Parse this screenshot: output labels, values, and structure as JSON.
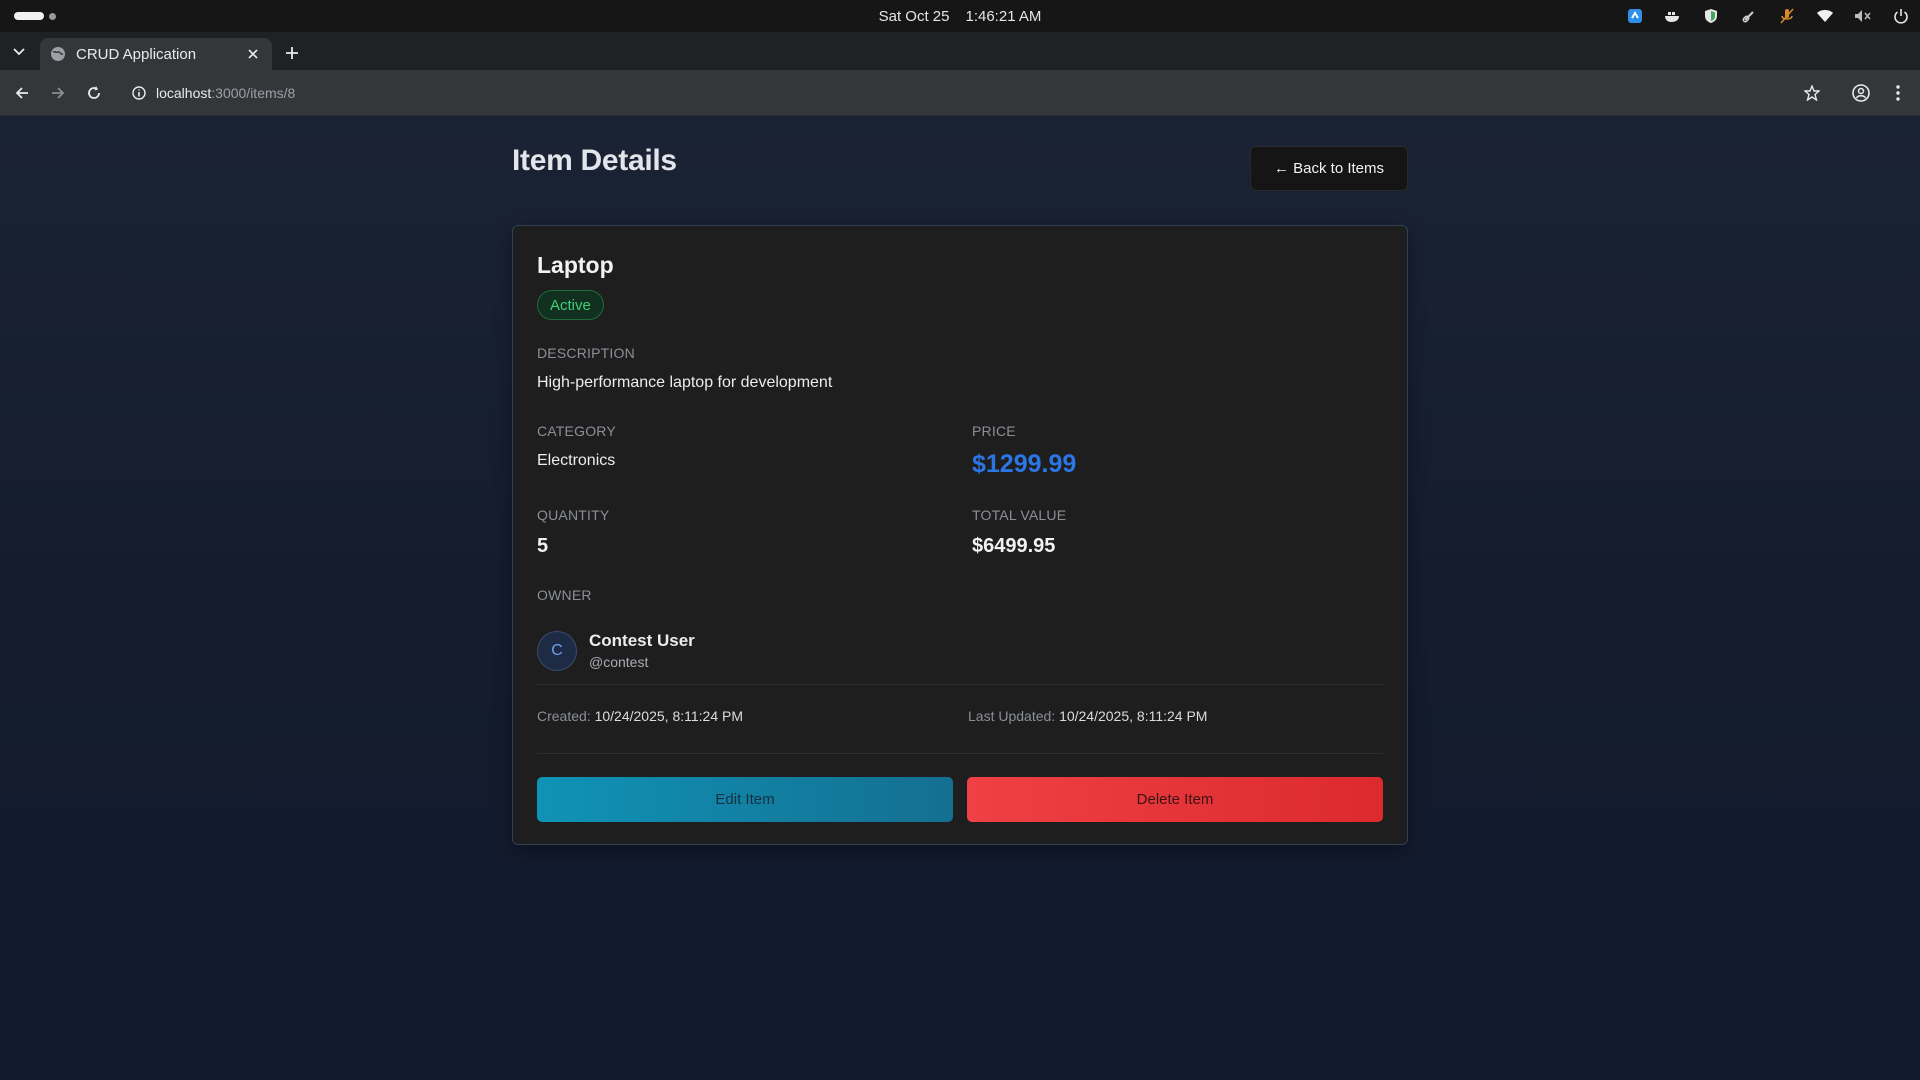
{
  "os": {
    "date": "Sat Oct 25",
    "time": "1:46:21 AM",
    "tray_icons": [
      "app-icon",
      "docker-icon",
      "shield-icon",
      "link-icon",
      "mic-off-icon",
      "wifi-icon",
      "volume-icon",
      "power-icon"
    ]
  },
  "browser": {
    "tab_title": "CRUD Application",
    "url_host": "localhost",
    "url_path": ":3000/items/8"
  },
  "page": {
    "title": "Item Details",
    "back_label": "← Back to Items"
  },
  "item": {
    "name": "Laptop",
    "status": "Active",
    "description_label": "DESCRIPTION",
    "description": "High-performance laptop for development",
    "category_label": "CATEGORY",
    "category": "Electronics",
    "price_label": "PRICE",
    "price": "$1299.99",
    "quantity_label": "QUANTITY",
    "quantity": "5",
    "total_label": "TOTAL VALUE",
    "total": "$6499.95",
    "owner_label": "OWNER",
    "owner_initial": "C",
    "owner_name": "Contest User",
    "owner_handle": "@contest",
    "created_label": "Created:",
    "created": "10/24/2025, 8:11:24 PM",
    "updated_label": "Last Updated:",
    "updated": "10/24/2025, 8:11:24 PM"
  },
  "actions": {
    "edit_label": "Edit Item",
    "delete_label": "Delete Item"
  },
  "colors": {
    "accent_price": "#2b76e5",
    "status_active": "#3fce78",
    "edit_button": "#0f93b6",
    "delete_button": "#ef4045"
  }
}
